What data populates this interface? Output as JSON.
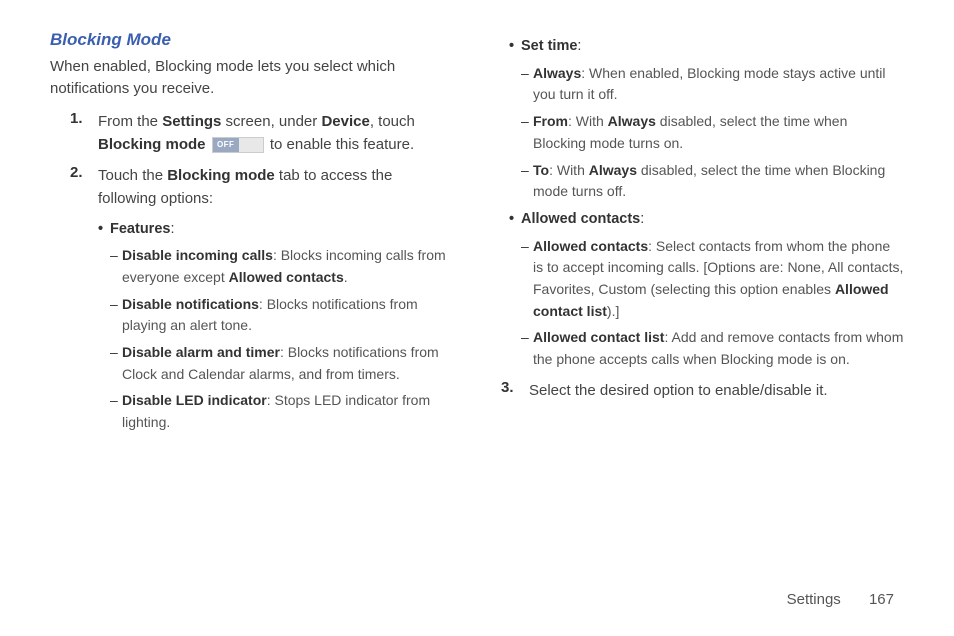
{
  "heading": "Blocking Mode",
  "intro": "When enabled, Blocking mode lets you select which notifications you receive.",
  "step1": {
    "num": "1.",
    "t1": "From the ",
    "b1": "Settings",
    "t2": " screen, under ",
    "b2": "Device",
    "t3": ", touch ",
    "b3": "Blocking mode",
    "toggle": "OFF",
    "t4": " to enable this feature."
  },
  "step2": {
    "num": "2.",
    "t1": "Touch the ",
    "b1": "Blocking mode",
    "t2": " tab to access the following options:"
  },
  "features": {
    "label": "Features",
    "colon": ":",
    "dic": {
      "b": "Disable incoming calls",
      "t1": ": Blocks incoming calls from everyone except ",
      "b2": "Allowed contacts",
      "t2": "."
    },
    "dn": {
      "b": "Disable notifications",
      "t": ": Blocks notifications from playing an alert tone."
    },
    "dat": {
      "b": "Disable alarm and timer",
      "t": ": Blocks notifications from Clock and Calendar alarms, and from timers."
    },
    "dled": {
      "b": "Disable LED indicator",
      "t": ": Stops LED indicator from lighting."
    }
  },
  "settime": {
    "label": "Set time",
    "colon": ":",
    "always": {
      "b": "Always",
      "t": ": When enabled, Blocking mode stays active until you turn it off."
    },
    "from": {
      "b": "From",
      "t1": ": With ",
      "b2": "Always",
      "t2": " disabled, select the time when Blocking mode turns on."
    },
    "to": {
      "b": "To",
      "t1": ": With ",
      "b2": "Always",
      "t2": " disabled, select the time when Blocking mode turns off."
    }
  },
  "allowed": {
    "label": "Allowed contacts",
    "colon": ":",
    "ac": {
      "b": "Allowed contacts",
      "t1": ": Select contacts from whom the phone is to accept incoming calls. [Options are: None, All contacts, Favorites, Custom (selecting this option enables ",
      "b2": "Allowed contact list",
      "t2": ").]"
    },
    "acl": {
      "b": "Allowed contact list",
      "t": ": Add and remove contacts from whom the phone accepts calls when Blocking mode is on."
    }
  },
  "step3": {
    "num": "3.",
    "t": "Select the desired option to enable/disable it."
  },
  "footer": {
    "section": "Settings",
    "page": "167"
  }
}
